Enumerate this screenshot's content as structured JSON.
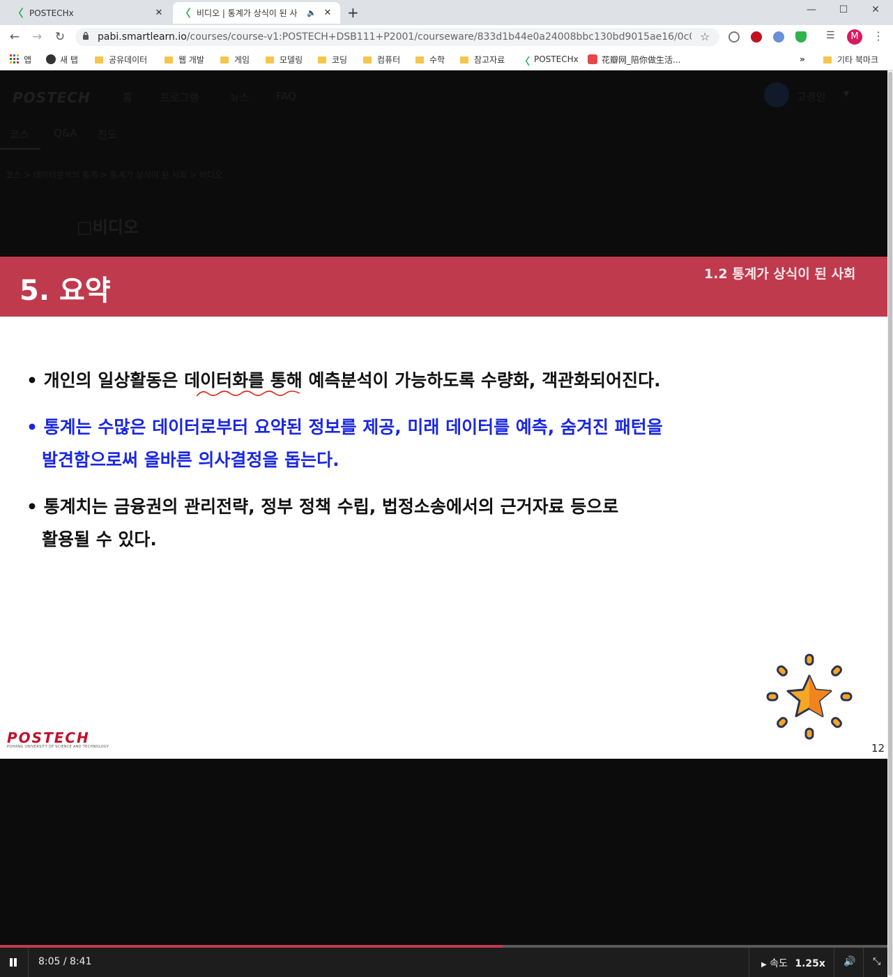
{
  "browser": {
    "tabs": [
      {
        "title": "POSTECHx",
        "active": false
      },
      {
        "title": "비디오 | 통계가 상식이 된 사",
        "active": true
      }
    ],
    "new_tab": "+",
    "window_controls": {
      "minimize": "—",
      "maximize": "☐",
      "close": "✕"
    },
    "url_host": "pabi.smartlearn.io",
    "url_path": "/courses/course-v1:POSTECH+DSB111+P2001/courseware/833d1b44e0a24008bbc130bd9015ae16/0c0e42e1d2514a8...",
    "profile_letter": "M",
    "bookmarks": [
      {
        "label": "앱",
        "icon": "apps-icon"
      },
      {
        "label": "새 탭",
        "icon": "globe-icon"
      },
      {
        "label": "공유데이터",
        "icon": "folder-icon"
      },
      {
        "label": "웹 개발",
        "icon": "folder-icon"
      },
      {
        "label": "게임",
        "icon": "folder-icon"
      },
      {
        "label": "모델링",
        "icon": "folder-icon"
      },
      {
        "label": "코딩",
        "icon": "folder-icon"
      },
      {
        "label": "컴퓨터",
        "icon": "folder-icon"
      },
      {
        "label": "수학",
        "icon": "folder-icon"
      },
      {
        "label": "참고자료",
        "icon": "folder-icon"
      },
      {
        "label": "POSTECHx",
        "icon": "postechx-icon"
      },
      {
        "label": "花瓣网_陪你做生活...",
        "icon": "huaban-icon"
      }
    ],
    "bookmarks_overflow": "»",
    "other_bookmarks": "기타 북마크"
  },
  "site": {
    "logo": "POSTECH",
    "nav": [
      "홈",
      "프로그램",
      "뉴스",
      "FAQ"
    ],
    "user_name": "고경인",
    "course_tabs": [
      "코스",
      "Q&A",
      "진도"
    ],
    "breadcrumb": [
      "코스",
      "데이터분석의 통계",
      "통계가 상식이 된 사회",
      "비디오"
    ],
    "breadcrumb_sep": ">",
    "unit_title": "비디오"
  },
  "slide": {
    "title": "5. 요약",
    "section": "1.2 통계가 상식이 된 사회",
    "bullets": [
      {
        "lines": [
          "• 개인의 일상활동은 데이터화를 통해 예측분석이 가능하도록 수량화, 객관화되어진다."
        ],
        "color": "#111111"
      },
      {
        "lines": [
          "• 통계는 수많은 데이터로부터 요약된 정보를 제공, 미래 데이터를 예측, 숨겨진 패턴을",
          "발견함으로써 올바른 의사결정을 돕는다."
        ],
        "color": "#1a27e0"
      },
      {
        "lines": [
          "• 통계치는 금융권의 관리전략, 정부 정책 수립, 법정소송에서의 근거자료 등으로",
          "활용될 수 있다."
        ],
        "color": "#111111"
      }
    ],
    "page_number": "12",
    "logo_text": "POSTECH",
    "logo_subtext": "POHANG UNIVERSITY OF SCIENCE AND TECHNOLOGY",
    "header_color": "#bf3a4d"
  },
  "player": {
    "time": "8:05 / 8:41",
    "progress": 0.566,
    "speed_label": "속도",
    "speed_value": "1.25x"
  }
}
